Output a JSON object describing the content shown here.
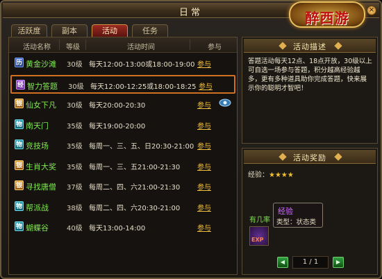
{
  "window": {
    "title": "日常",
    "logo_text": "醉西游",
    "close": "×"
  },
  "tabs": [
    {
      "label": "活跃度",
      "active": false
    },
    {
      "label": "副本",
      "active": false
    },
    {
      "label": "活动",
      "active": true
    },
    {
      "label": "任务",
      "active": false
    }
  ],
  "table": {
    "headers": {
      "name": "活动名称",
      "level": "等级",
      "time": "活动时间",
      "join": "参与"
    },
    "rows": [
      {
        "icon_char": "历",
        "icon_color": "blue",
        "name": "黄金沙滩",
        "name_color": "#80e850",
        "level": "30级",
        "time": "每天12:00-13:00或18:00-19:00",
        "join": "参与",
        "selected": false
      },
      {
        "icon_char": "经",
        "icon_color": "purple",
        "name": "智力答题",
        "name_color": "#80e850",
        "level": "30级",
        "time": "每天12:00-12:25或18:00-18:25",
        "join": "参与",
        "selected": true
      },
      {
        "icon_char": "银",
        "icon_color": "orange",
        "name": "仙女下凡",
        "name_color": "#80e850",
        "level": "30级",
        "time": "每天20:00-20:30",
        "join": "参与",
        "selected": false,
        "extra_icon": "eye-icon"
      },
      {
        "icon_char": "物",
        "icon_color": "teal",
        "name": "南天门",
        "name_color": "#80e850",
        "level": "35级",
        "time": "每天19:00-20:00",
        "join": "参与",
        "selected": false
      },
      {
        "icon_char": "物",
        "icon_color": "teal",
        "name": "竞技场",
        "name_color": "#80e850",
        "level": "35级",
        "time": "每周一、三、五、日20:30-21:00",
        "join": "参与",
        "selected": false
      },
      {
        "icon_char": "银",
        "icon_color": "orange",
        "name": "生肖大奖",
        "name_color": "#80e850",
        "level": "35级",
        "time": "每周一、三、五21:00-21:30",
        "join": "参与",
        "selected": false
      },
      {
        "icon_char": "银",
        "icon_color": "orange",
        "name": "寻找唐僧",
        "name_color": "#80e850",
        "level": "37级",
        "time": "每周二、四、六21:00-21:30",
        "join": "参与",
        "selected": false
      },
      {
        "icon_char": "物",
        "icon_color": "teal",
        "name": "帮派战",
        "name_color": "#80e850",
        "level": "38级",
        "time": "每周二、四、六20:30-21:00",
        "join": "参与",
        "selected": false
      },
      {
        "icon_char": "物",
        "icon_color": "teal",
        "name": "蝴蝶谷",
        "name_color": "#80e850",
        "level": "40级",
        "time": "每天13:00-14:00",
        "join": "参与",
        "selected": false
      }
    ]
  },
  "description": {
    "title": "活动描述",
    "text": "答题活动每天12点、18点开放，30级以上可自选一场参与答题，积分越高经验越多，更有多种道具助你完成答题，快来展示你的聪明才智吧！"
  },
  "rewards": {
    "title": "活动奖励",
    "exp_label": "经验：",
    "exp_stars": "★★★★",
    "hint_label": "有几率",
    "tooltip_title": "经验",
    "tooltip_sub": "类型：状态类",
    "item_tag": "EXP",
    "page_text": "1 / 1",
    "prev": "◀",
    "next": "▶"
  }
}
